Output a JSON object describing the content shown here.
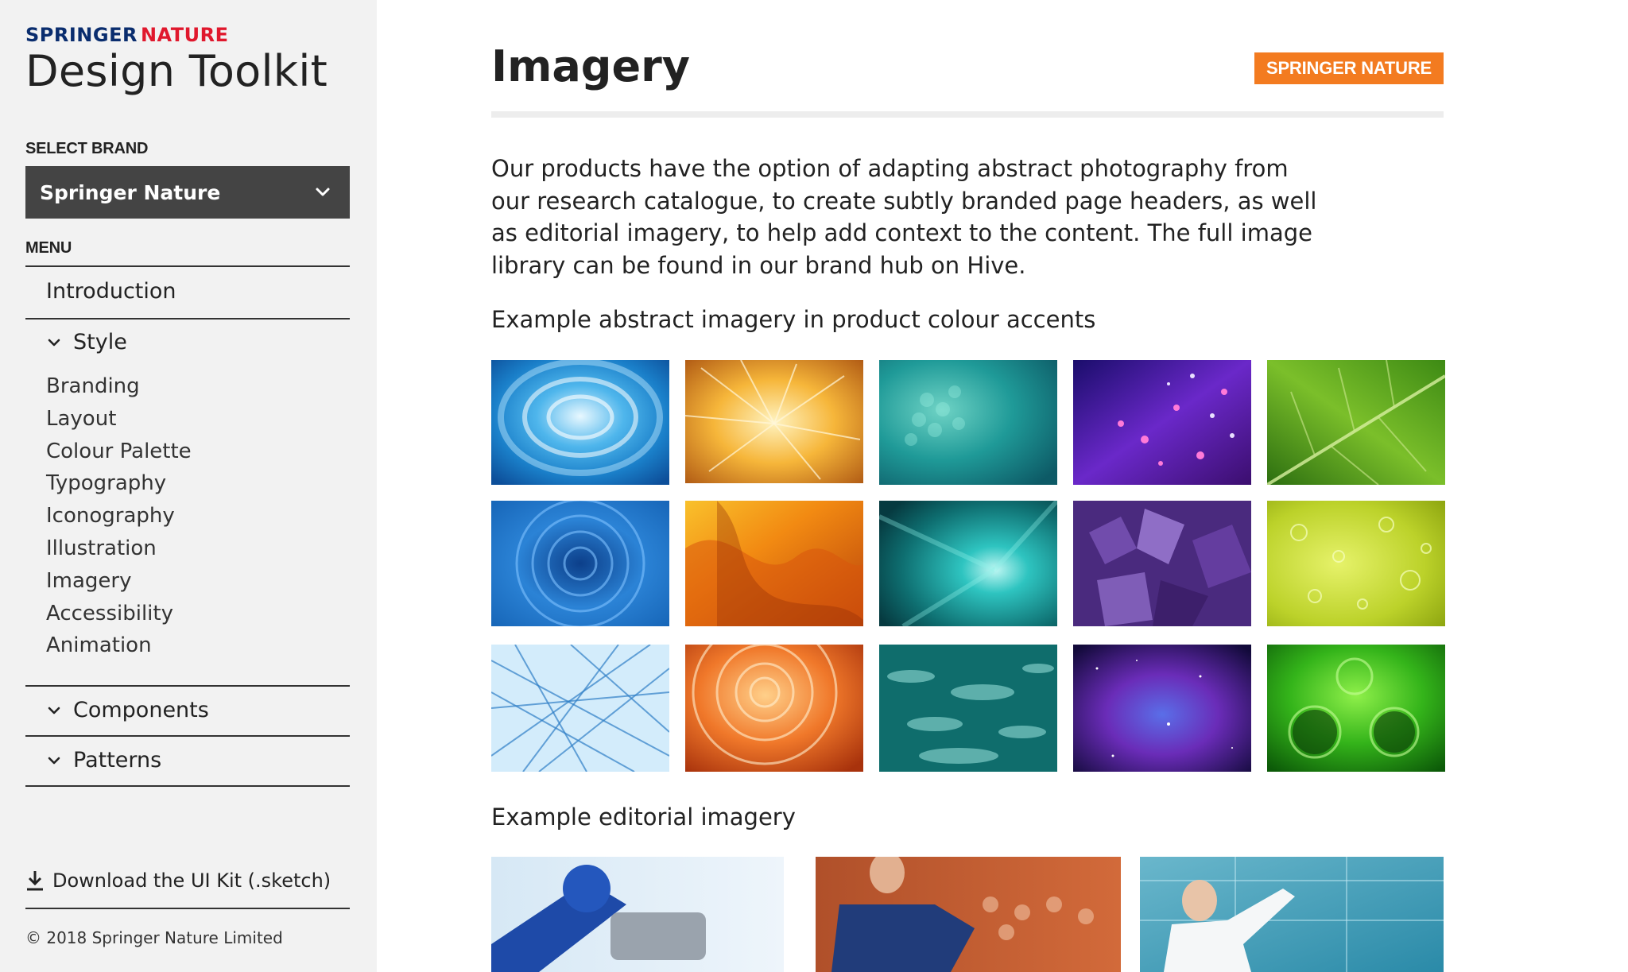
{
  "sidebar": {
    "logo": {
      "springer": "SPRINGER",
      "nature": "NATURE",
      "title": "Design Toolkit"
    },
    "select_brand_label": "SELECT BRAND",
    "brand_select": {
      "value": "Springer Nature",
      "icon": "chevron-down-icon"
    },
    "menu_label": "MENU",
    "menu": {
      "introduction": "Introduction",
      "style": "Style",
      "style_items": [
        "Branding",
        "Layout",
        "Colour Palette",
        "Typography",
        "Iconography",
        "Illustration",
        "Imagery",
        "Accessibility",
        "Animation"
      ],
      "components": "Components",
      "patterns": "Patterns"
    },
    "download": {
      "label": "Download the UI Kit (.sketch)",
      "icon": "download-icon"
    },
    "copyright": "© 2018 Springer Nature Limited"
  },
  "main": {
    "title": "Imagery",
    "badge": "SPRINGER NATURE",
    "intro": "Our products have the option of adapting abstract photography from our research catalogue, to create subtly branded page headers, as well as editorial imagery, to help add context to the content. The full image library can be found in our brand hub on Hive.",
    "abstract_heading": "Example abstract imagery in product colour accents",
    "editorial_heading": "Example editorial imagery"
  },
  "colors": {
    "badge": "#f37b20",
    "select_bg": "#444444",
    "sidebar_bg": "#f2f2f2",
    "logo_springer": "#0a2d6e",
    "logo_nature": "#e0182d"
  }
}
